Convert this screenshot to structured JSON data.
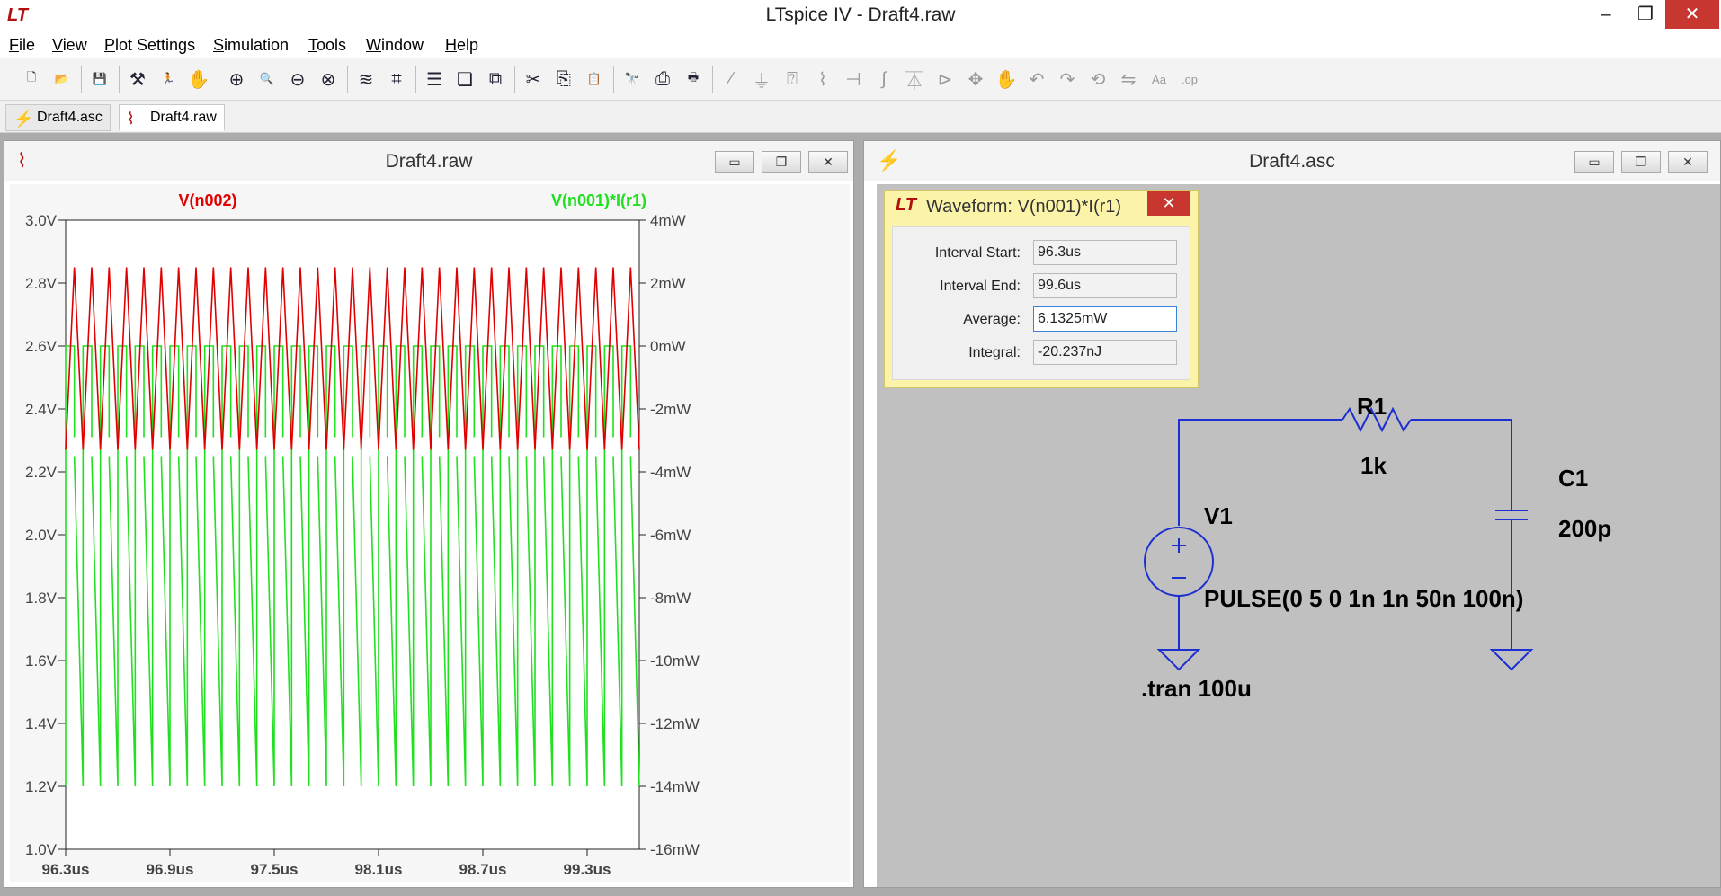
{
  "app": {
    "window_title": "LTspice IV - Draft4.raw",
    "logo_glyph": "LT",
    "controls": {
      "minimize": "–",
      "maximize": "❐",
      "close": "✕"
    }
  },
  "menu": [
    {
      "label": "File"
    },
    {
      "label": "View"
    },
    {
      "label": "Plot Settings"
    },
    {
      "label": "Simulation"
    },
    {
      "label": "Tools"
    },
    {
      "label": "Window"
    },
    {
      "label": "Help"
    }
  ],
  "toolbar": [
    {
      "name": "new-schematic-icon",
      "glyph": "🗋"
    },
    {
      "name": "open-icon",
      "glyph": "📂"
    },
    {
      "name": "save-icon",
      "glyph": "💾"
    },
    {
      "name": "control-panel-icon",
      "glyph": "⚒"
    },
    {
      "name": "run-icon",
      "glyph": "🏃"
    },
    {
      "name": "halt-icon",
      "glyph": "✋"
    },
    {
      "name": "zoom-area-icon",
      "glyph": "⊕"
    },
    {
      "name": "pan-icon",
      "glyph": "🔍"
    },
    {
      "name": "zoom-back-icon",
      "glyph": "⊖"
    },
    {
      "name": "zoom-fit-icon",
      "glyph": "⊗"
    },
    {
      "name": "autorange-icon",
      "glyph": "≋"
    },
    {
      "name": "manual-limits-icon",
      "glyph": "⌗"
    },
    {
      "name": "tile-horizontal-icon",
      "glyph": "☰"
    },
    {
      "name": "cascade-icon",
      "glyph": "❏"
    },
    {
      "name": "close-all-icon",
      "glyph": "⧉"
    },
    {
      "name": "cut-icon",
      "glyph": "✂"
    },
    {
      "name": "copy-icon",
      "glyph": "⎘"
    },
    {
      "name": "paste-icon",
      "glyph": "📋"
    },
    {
      "name": "find-icon",
      "glyph": "🔭"
    },
    {
      "name": "print-setup-icon",
      "glyph": "⎙"
    },
    {
      "name": "print-icon",
      "glyph": "🖶"
    },
    {
      "name": "wire-icon",
      "glyph": "∕"
    },
    {
      "name": "ground-icon",
      "glyph": "⏚"
    },
    {
      "name": "label-net-icon",
      "glyph": "⍰"
    },
    {
      "name": "resistor-icon",
      "glyph": "⌇"
    },
    {
      "name": "capacitor-icon",
      "glyph": "⊣"
    },
    {
      "name": "inductor-icon",
      "glyph": "∫"
    },
    {
      "name": "diode-icon",
      "glyph": "⏄"
    },
    {
      "name": "component-icon",
      "glyph": "⊳"
    },
    {
      "name": "move-icon",
      "glyph": "✥"
    },
    {
      "name": "drag-icon",
      "glyph": "✋"
    },
    {
      "name": "undo-icon",
      "glyph": "↶"
    },
    {
      "name": "redo-icon",
      "glyph": "↷"
    },
    {
      "name": "rotate-icon",
      "glyph": "⟲"
    },
    {
      "name": "mirror-icon",
      "glyph": "⇋"
    },
    {
      "name": "text-icon",
      "glyph": "Aa"
    },
    {
      "name": "spice-directive-icon",
      "glyph": ".op"
    }
  ],
  "doc_tabs": [
    {
      "label": "Draft4.asc",
      "icon": "schematic-icon",
      "active": false
    },
    {
      "label": "Draft4.raw",
      "icon": "waveform-icon",
      "active": true
    }
  ],
  "plot_window": {
    "title": "Draft4.raw",
    "controls": {
      "minimize": "▭",
      "restore": "❐",
      "close": "✕"
    }
  },
  "schematic_window": {
    "title": "Draft4.asc",
    "controls": {
      "minimize": "▭",
      "restore": "❐",
      "close": "✕"
    }
  },
  "waveform_dialog": {
    "title": "Waveform: V(n001)*I(r1)",
    "close": "✕",
    "rows": [
      {
        "label": "Interval Start:",
        "value": "96.3us"
      },
      {
        "label": "Interval End:",
        "value": "99.6us"
      },
      {
        "label": "Average:",
        "value": "6.1325mW"
      },
      {
        "label": "Integral:",
        "value": "-20.237nJ"
      }
    ]
  },
  "schematic": {
    "components": {
      "r1_name": "R1",
      "r1_value": "1k",
      "c1_name": "C1",
      "c1_value": "200p",
      "v1_name": "V1",
      "v1_value": "PULSE(0 5 0 1n 1n 50n 100n)"
    },
    "directive": ".tran 100u",
    "wire_color": "#1c2fd0",
    "symbol_color": "#1c2fd0"
  },
  "chart_data": {
    "type": "line",
    "background": "#f6f6f6",
    "x": {
      "label": "",
      "range_us": [
        96.3,
        99.6
      ],
      "ticks_us": [
        96.3,
        96.9,
        97.5,
        98.1,
        98.7,
        99.3
      ],
      "tick_labels": [
        "96.3us",
        "96.9us",
        "97.5us",
        "98.1us",
        "98.7us",
        "99.3us"
      ]
    },
    "y_left": {
      "range": [
        1.0,
        3.0
      ],
      "ticks": [
        3.0,
        2.8,
        2.6,
        2.4,
        2.2,
        2.0,
        1.8,
        1.6,
        1.4,
        1.2,
        1.0
      ],
      "tick_labels": [
        "3.0V",
        "2.8V",
        "2.6V",
        "2.4V",
        "2.2V",
        "2.0V",
        "1.8V",
        "1.6V",
        "1.4V",
        "1.2V",
        "1.0V"
      ]
    },
    "y_right": {
      "range": [
        -16,
        4
      ],
      "ticks": [
        4,
        2,
        0,
        -2,
        -4,
        -6,
        -8,
        -10,
        -12,
        -14,
        -16
      ],
      "tick_labels": [
        "4mW",
        "2mW",
        "0mW",
        "-2mW",
        "-4mW",
        "-6mW",
        "-8mW",
        "-10mW",
        "-12mW",
        "-14mW",
        "-16mW"
      ]
    },
    "series": [
      {
        "name": "V(n002)",
        "color": "#e00000",
        "axis": "left",
        "period_us": 0.1,
        "pulse_high_us": 0.05,
        "v_peak": 2.85,
        "v_valley": 2.27
      },
      {
        "name": "V(n001)*I(r1)",
        "color": "#20e020",
        "axis": "right",
        "period_us": 0.1,
        "pulse_high_us": 0.05,
        "high_segment_mw": [
          -2.9,
          -0.8
        ],
        "low_segment_mw": [
          -14.0,
          -3.5
        ],
        "flat_mw": 0.0
      }
    ],
    "annotations": [
      {
        "text": "V(n002)",
        "color": "#e00000"
      },
      {
        "text": "V(n001)*I(r1)",
        "color": "#20e020"
      }
    ]
  }
}
